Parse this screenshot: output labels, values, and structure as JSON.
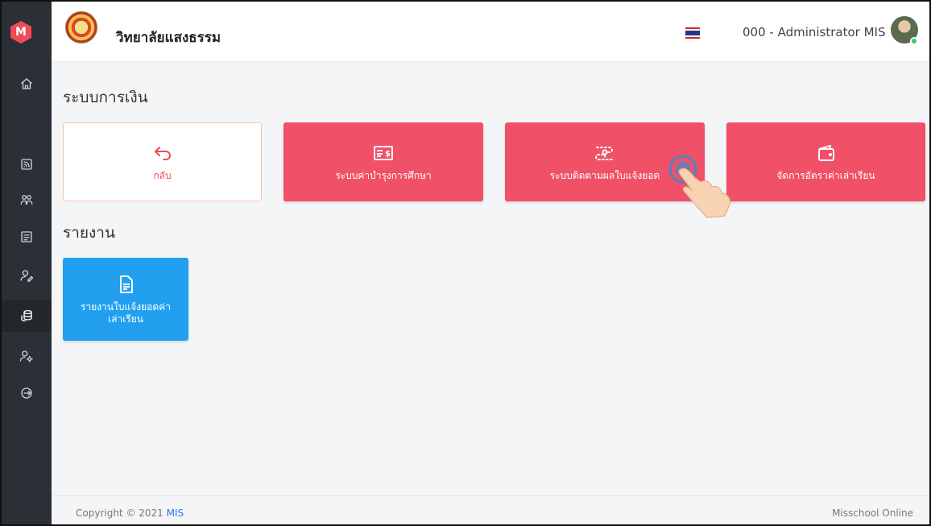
{
  "sidebar": {
    "logo_letter": "M",
    "brand_color": "#ef4b57",
    "items": [
      {
        "icon": "home-icon"
      },
      {
        "icon": "rss-icon"
      },
      {
        "icon": "users-icon"
      },
      {
        "icon": "id-card-icon"
      },
      {
        "icon": "user-edit-icon"
      },
      {
        "icon": "coins-icon",
        "active": true
      },
      {
        "icon": "user-settings-icon"
      },
      {
        "icon": "logout-icon"
      }
    ]
  },
  "header": {
    "school_name": "วิทยาลัยแสงธรรม",
    "language_icon": "thai-flag-icon",
    "user_name": "000 - Administrator MIS"
  },
  "main": {
    "finance_title": "ระบบการเงิน",
    "finance_tiles": [
      {
        "label": "กลับ",
        "icon": "back-arrow-icon"
      },
      {
        "label": "ระบบค่าบำรุงการศึกษา",
        "icon": "cheque-icon"
      },
      {
        "label": "ระบบติดตามผลใบแจ้งยอด",
        "icon": "route-tracking-icon"
      },
      {
        "label": "จัดการอัตราค่าเล่าเรียน",
        "icon": "wallet-icon"
      }
    ],
    "report_title": "รายงาน",
    "report_tiles": [
      {
        "label": "รายงานใบแจ้งยอดค่าเล่าเรียน",
        "label_line1": "รายงานใบแจ้งยอดค่า",
        "label_line2": "เล่าเรียน",
        "icon": "document-icon"
      }
    ]
  },
  "footer": {
    "copyright_prefix": "Copyright © 2021 ",
    "copyright_link": "MIS",
    "brand": "Misschool Online"
  },
  "colors": {
    "tile_red": "#f05068",
    "tile_blue": "#22a0ef",
    "sidebar_bg": "#2b3036",
    "link_blue": "#2f7ae5"
  }
}
